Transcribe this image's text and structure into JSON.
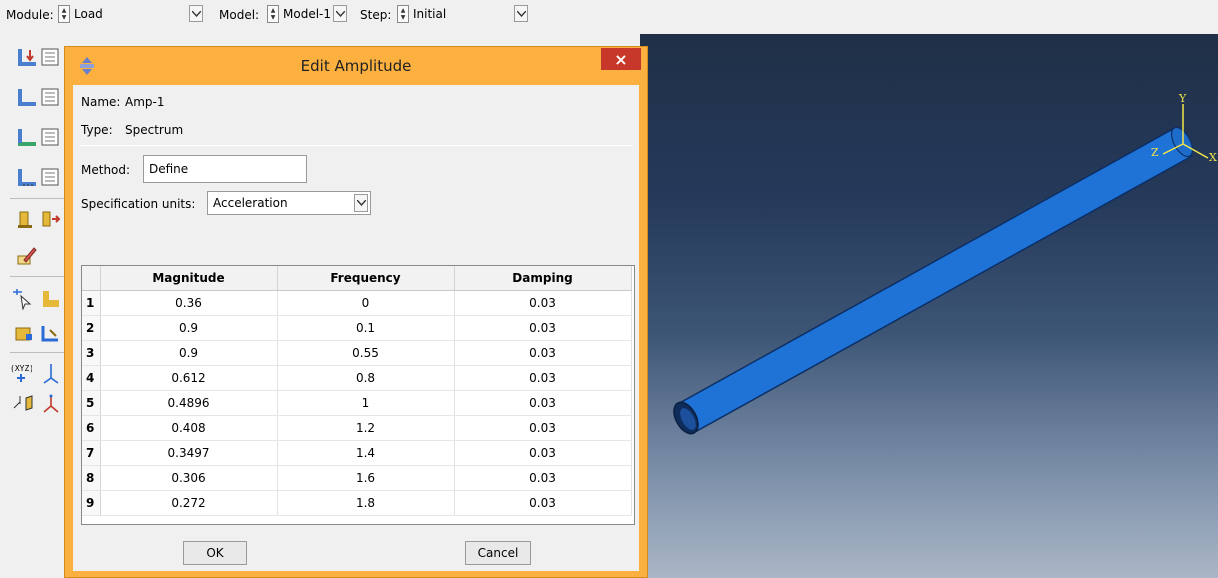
{
  "context_bar": {
    "module_label": "Module:",
    "module_value": "Load",
    "model_label": "Model:",
    "model_value": "Model-1",
    "step_label": "Step:",
    "step_value": "Initial"
  },
  "dialog": {
    "title": "Edit Amplitude",
    "close_glyph": "×",
    "name_label": "Name:",
    "name_value": "Amp-1",
    "type_label": "Type:",
    "type_value": "Spectrum",
    "method_label": "Method:",
    "method_value": "Define",
    "units_label": "Specification units:",
    "units_value": "Acceleration",
    "table": {
      "columns": [
        "Magnitude",
        "Frequency",
        "Damping"
      ],
      "rows": [
        {
          "num": "1",
          "magnitude": "0.36",
          "frequency": "0",
          "damping": "0.03"
        },
        {
          "num": "2",
          "magnitude": "0.9",
          "frequency": "0.1",
          "damping": "0.03"
        },
        {
          "num": "3",
          "magnitude": "0.9",
          "frequency": "0.55",
          "damping": "0.03"
        },
        {
          "num": "4",
          "magnitude": "0.612",
          "frequency": "0.8",
          "damping": "0.03"
        },
        {
          "num": "5",
          "magnitude": "0.4896",
          "frequency": "1",
          "damping": "0.03"
        },
        {
          "num": "6",
          "magnitude": "0.408",
          "frequency": "1.2",
          "damping": "0.03"
        },
        {
          "num": "7",
          "magnitude": "0.3497",
          "frequency": "1.4",
          "damping": "0.03"
        },
        {
          "num": "8",
          "magnitude": "0.306",
          "frequency": "1.6",
          "damping": "0.03"
        },
        {
          "num": "9",
          "magnitude": "0.272",
          "frequency": "1.8",
          "damping": "0.03"
        }
      ]
    },
    "ok_label": "OK",
    "cancel_label": "Cancel"
  },
  "viewport": {
    "axis_y": "Y",
    "axis_z": "Z",
    "axis_x": "X"
  },
  "colors": {
    "dialog_frame": "#fbb040",
    "close_button": "#c7372a",
    "pipe": "#1f73d6",
    "viewport_top": "#1f3047",
    "viewport_bottom": "#aab6c6"
  }
}
